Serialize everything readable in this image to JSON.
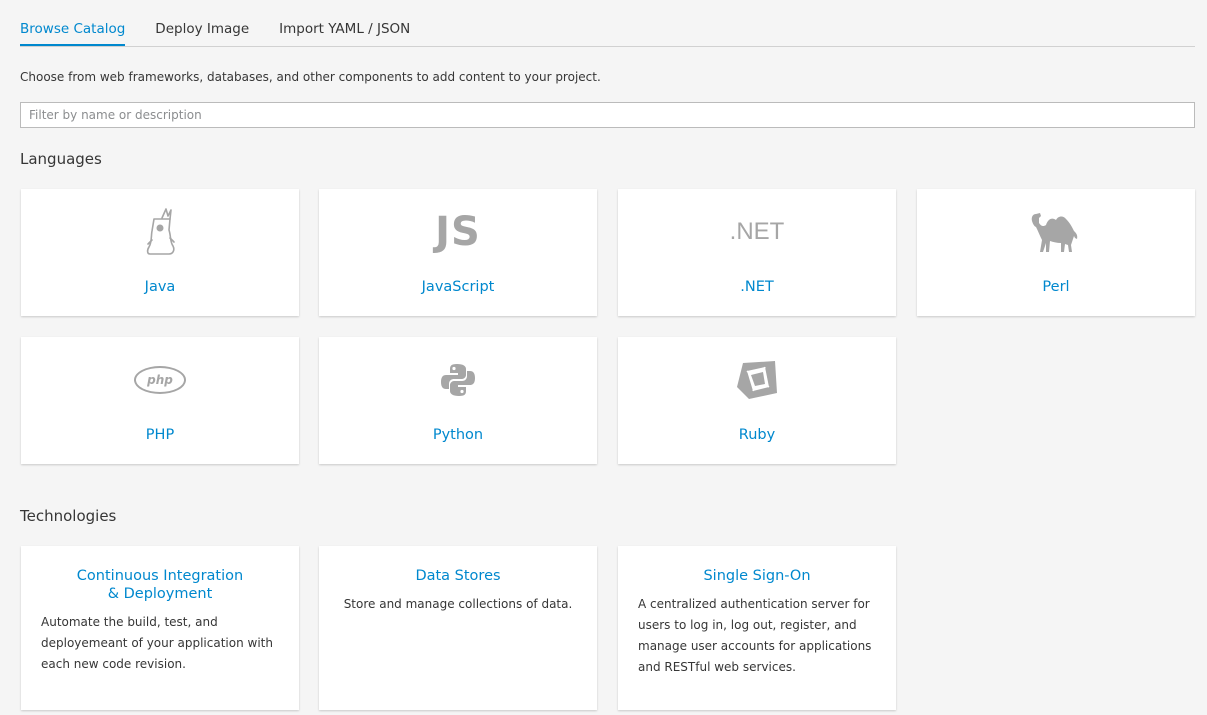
{
  "tabs": [
    {
      "label": "Browse Catalog",
      "active": true
    },
    {
      "label": "Deploy Image",
      "active": false
    },
    {
      "label": "Import YAML / JSON",
      "active": false
    }
  ],
  "intro": "Choose from web frameworks, databases, and other components to add content to your project.",
  "filter": {
    "placeholder": "Filter by name or description",
    "value": ""
  },
  "languages": {
    "title": "Languages",
    "items": [
      {
        "label": "Java",
        "icon": "java-duke-icon"
      },
      {
        "label": "JavaScript",
        "icon": "js-icon",
        "icon_text": "JS"
      },
      {
        "label": ".NET",
        "icon": "dotnet-icon",
        "icon_text": ".NET"
      },
      {
        "label": "Perl",
        "icon": "perl-camel-icon"
      },
      {
        "label": "PHP",
        "icon": "php-icon",
        "icon_text": "php"
      },
      {
        "label": "Python",
        "icon": "python-icon"
      },
      {
        "label": "Ruby",
        "icon": "ruby-icon"
      }
    ]
  },
  "technologies": {
    "title": "Technologies",
    "items": [
      {
        "title": "Continuous Integration\n& Deployment",
        "description": "Automate the build, test, and deployemeant of your application with each new code revision."
      },
      {
        "title": "Data Stores",
        "description": "Store and manage collections of data."
      },
      {
        "title": "Single Sign-On",
        "description": "A centralized authentication server for users to log in, log out, register, and manage user accounts for applications and RESTful web services."
      }
    ]
  },
  "colors": {
    "accent": "#0088ce",
    "icon_gray": "#a6a6a6",
    "background": "#f5f5f5",
    "card": "#ffffff"
  }
}
